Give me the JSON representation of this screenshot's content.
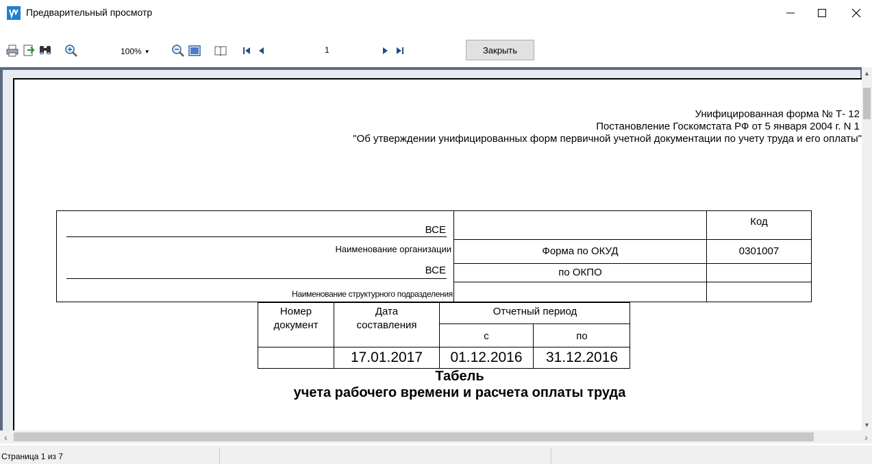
{
  "window": {
    "title": "Предварительный просмотр"
  },
  "toolbar": {
    "zoom": "100%",
    "page_number": "1",
    "close_label": "Закрыть"
  },
  "document": {
    "form_header": {
      "line1": "Унифицированная  форма №  Т- 12",
      "line2": "Постановление Госкомстата РФ от 5 января 2004 г. N 1",
      "line3": "\"Об утверждении унифицированных форм первичной учетной документации по учету труда и его оплаты\""
    },
    "org": {
      "name_value": "ВСЕ",
      "name_caption": "Наименование организации",
      "division_value": "ВСЕ",
      "division_caption": "Наименование структурного подразделения"
    },
    "codes": {
      "code_header": "Код",
      "okud_label": "Форма по ОКУД",
      "okud_value": "0301007",
      "okpo_label": "по ОКПО",
      "okpo_value": ""
    },
    "doc_table": {
      "number_header_line1": "Номер",
      "number_header_line2": "документ",
      "date_header_line1": "Дата",
      "date_header_line2": "составления",
      "period_header": "Отчетный период",
      "from_header": "с",
      "to_header": "по",
      "number_value": "",
      "date_value": "17.01.2017",
      "from_value": "01.12.2016",
      "to_value": "31.12.2016"
    },
    "title_line1": "Табель",
    "title_line2": "учета рабочего времени и расчета оплаты труда"
  },
  "status": {
    "page_info": "Страница 1 из 7"
  },
  "colors": {
    "preview_background": "#5b6b7f",
    "app_icon": "#1f7fd0"
  },
  "icons": [
    "app-icon",
    "print-icon",
    "export-icon",
    "find-icon",
    "zoom-in-icon",
    "zoom-out-icon",
    "page-width-icon",
    "book-icon",
    "first-page-icon",
    "prev-page-icon",
    "next-page-icon",
    "last-page-icon",
    "minimize-icon",
    "maximize-icon",
    "close-icon"
  ]
}
